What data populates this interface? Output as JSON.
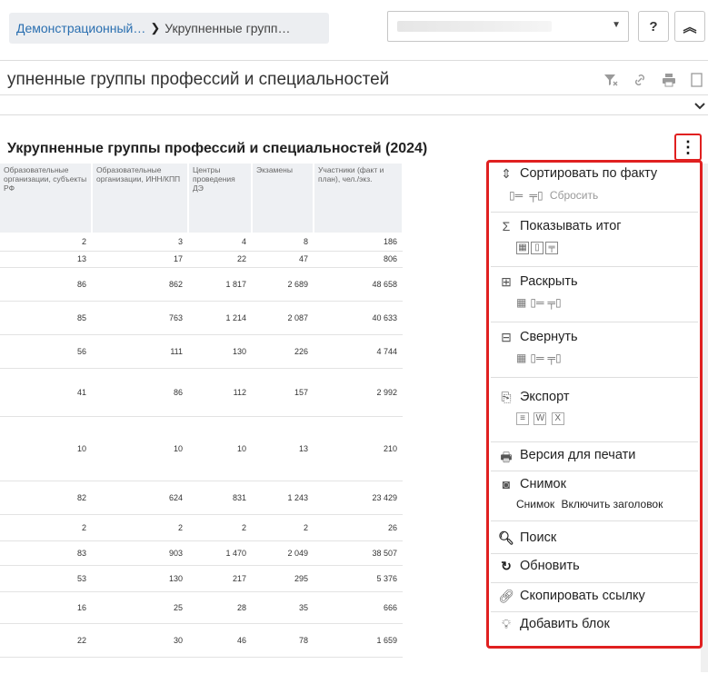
{
  "breadcrumb": {
    "parent": "Демонстрационный…",
    "separator": "❯",
    "current": "Укрупненные групп…"
  },
  "header": {
    "help_label": "?",
    "collapse_label": "≪"
  },
  "page": {
    "title": "упненные группы профессий и специальностей"
  },
  "block": {
    "title": "Укрупненные группы профессий и специальностей (2024)",
    "menu_icon": "⋮"
  },
  "table": {
    "columns": [
      "Образовательные организации, субъекты РФ",
      "Образовательные организации, ИНН/КПП",
      "Центры проведения ДЭ",
      "Экзамены",
      "Участники (факт и план), чел./экз."
    ],
    "rows": [
      [
        "2",
        "3",
        "4",
        "8",
        "186"
      ],
      [
        "13",
        "17",
        "22",
        "47",
        "806"
      ],
      [
        "86",
        "862",
        "1 817",
        "2 689",
        "48 658"
      ],
      [
        "85",
        "763",
        "1 214",
        "2 087",
        "40 633"
      ],
      [
        "56",
        "111",
        "130",
        "226",
        "4 744"
      ],
      [
        "41",
        "86",
        "112",
        "157",
        "2 992"
      ],
      [
        "10",
        "10",
        "10",
        "13",
        "210"
      ],
      [
        "82",
        "624",
        "831",
        "1 243",
        "23 429"
      ],
      [
        "2",
        "2",
        "2",
        "2",
        "26"
      ],
      [
        "83",
        "903",
        "1 470",
        "2 049",
        "38 507"
      ],
      [
        "53",
        "130",
        "217",
        "295",
        "5 376"
      ],
      [
        "16",
        "25",
        "28",
        "35",
        "666"
      ],
      [
        "22",
        "30",
        "46",
        "78",
        "1 659"
      ]
    ]
  },
  "menu": {
    "sort": {
      "label": "Сортировать по факту",
      "reset": "Сбросить"
    },
    "totals": {
      "label": "Показывать итог"
    },
    "expand": {
      "label": "Раскрыть"
    },
    "collapse": {
      "label": "Свернуть"
    },
    "export": {
      "label": "Экспорт"
    },
    "print": {
      "label": "Версия для печати"
    },
    "snapshot": {
      "label": "Снимок",
      "sub_snapshot": "Снимок",
      "sub_title": "Включить заголовок"
    },
    "search": {
      "label": "Поиск"
    },
    "refresh": {
      "label": "Обновить"
    },
    "copy_link": {
      "label": "Скопировать ссылку"
    },
    "add_block": {
      "label": "Добавить блок"
    }
  },
  "colors": {
    "accent_link": "#2a6fb0",
    "highlight_border": "#e02020"
  }
}
